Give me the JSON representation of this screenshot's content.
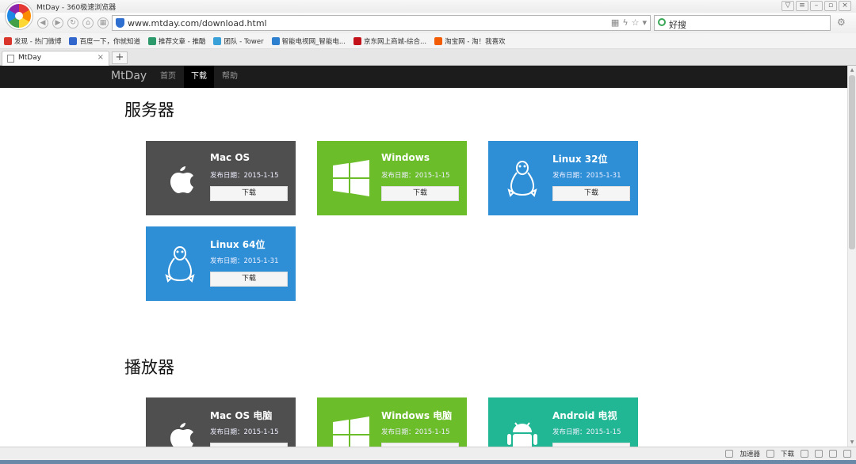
{
  "window": {
    "title": "MtDay - 360极速浏览器"
  },
  "toolbar": {
    "url": "www.mtday.com/download.html",
    "search_value": "好搜"
  },
  "bookmarks": [
    {
      "label": "发现 - 热门微博",
      "color": "#d9352b"
    },
    {
      "label": "百度一下，你就知道",
      "color": "#3266cc"
    },
    {
      "label": "推荐文章 - 推酷",
      "color": "#2c9a6b"
    },
    {
      "label": "团队 - Tower",
      "color": "#3aa0d8"
    },
    {
      "label": "智能电视网_智能电...",
      "color": "#2d7fd0"
    },
    {
      "label": "京东网上商城-综合...",
      "color": "#c3121a"
    },
    {
      "label": "淘宝网 - 淘！我喜欢",
      "color": "#f25c05"
    }
  ],
  "tab": {
    "title": "MtDay",
    "close": "×",
    "new": "+"
  },
  "site": {
    "brand": "MtDay",
    "nav": [
      "首页",
      "下载",
      "帮助"
    ]
  },
  "sections": {
    "server": "服务器",
    "player": "播放器"
  },
  "server_cards": [
    {
      "name": "Mac OS",
      "date": "发布日期：2015-1-15",
      "button": "下载",
      "color": "#4f4f4f",
      "icon": "apple-icon"
    },
    {
      "name": "Windows",
      "date": "发布日期：2015-1-15",
      "button": "下载",
      "color": "#6cbd2a",
      "icon": "windows-icon"
    },
    {
      "name": "Linux 32位",
      "date": "发布日期：2015-1-31",
      "button": "下载",
      "color": "#2e8fd6",
      "icon": "linux-penguin-icon"
    },
    {
      "name": "Linux 64位",
      "date": "发布日期：2015-1-31",
      "button": "下载",
      "color": "#2e8fd6",
      "icon": "linux-penguin-icon"
    }
  ],
  "player_cards": [
    {
      "name": "Mac OS 电脑",
      "date": "发布日期：2015-1-15",
      "color": "#4f4f4f",
      "icon": "apple-icon"
    },
    {
      "name": "Windows 电脑",
      "date": "发布日期：2015-1-15",
      "color": "#6cbd2a",
      "icon": "windows-icon"
    },
    {
      "name": "Android 电视",
      "date": "发布日期：2015-1-15",
      "color": "#22b794",
      "icon": "android-icon"
    }
  ],
  "statusbar": {
    "accelerator": "加速器",
    "download": "下载"
  }
}
